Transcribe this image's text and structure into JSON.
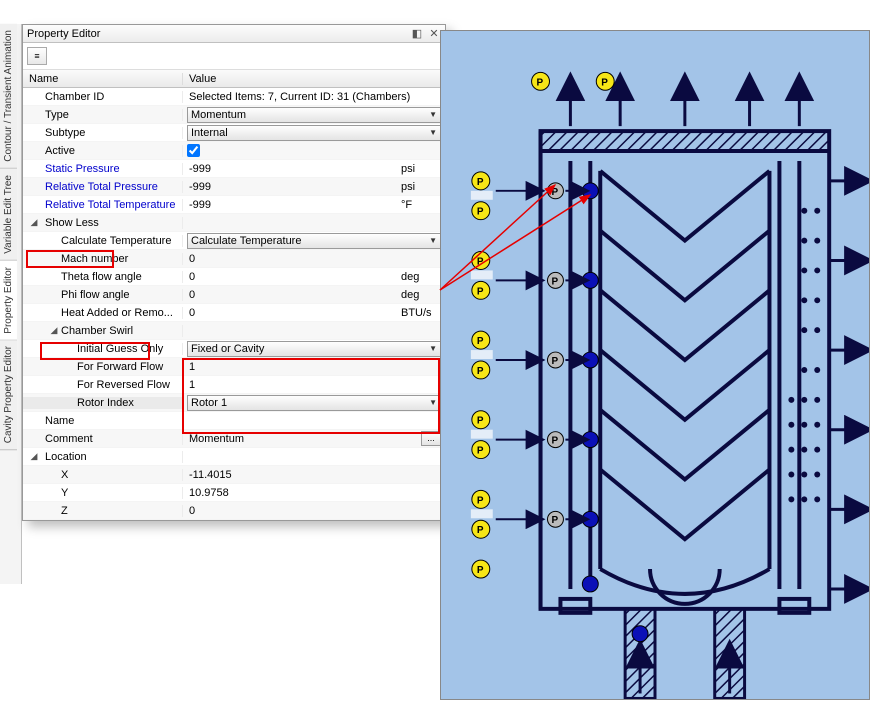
{
  "panel": {
    "title": "Property Editor",
    "toolbar_btn": "≡",
    "header_name": "Name",
    "header_value": "Value"
  },
  "vtabs": {
    "t1": "Contour / Transient Animation",
    "t2": "Variable Edit Tree",
    "t3": "Property Editor",
    "t4": "Cavity Property Editor"
  },
  "rows": {
    "chamber_id_label": "Chamber ID",
    "chamber_id_value": "Selected Items: 7, Current ID: 31 (Chambers)",
    "type_label": "Type",
    "type_value": "Momentum",
    "subtype_label": "Subtype",
    "subtype_value": "Internal",
    "active_label": "Active",
    "static_p_label": "Static Pressure",
    "static_p_value": "-999",
    "static_p_unit": "psi",
    "rel_totp_label": "Relative Total Pressure",
    "rel_totp_value": "-999",
    "rel_totp_unit": "psi",
    "rel_tott_label": "Relative Total Temperature",
    "rel_tott_value": "-999",
    "rel_tott_unit": "°F",
    "show_less_label": "Show Less",
    "calc_temp_label": "Calculate Temperature",
    "calc_temp_value": "Calculate Temperature",
    "mach_label": "Mach number",
    "mach_value": "0",
    "theta_label": "Theta flow angle",
    "theta_value": "0",
    "theta_unit": "deg",
    "phi_label": "Phi flow angle",
    "phi_value": "0",
    "phi_unit": "deg",
    "heat_label": "Heat Added or Remo...",
    "heat_value": "0",
    "heat_unit": "BTU/s",
    "chamber_swirl_label": "Chamber Swirl",
    "ig_label": "Initial Guess Only",
    "ig_value": "Fixed or Cavity",
    "fwd_label": "For Forward Flow",
    "fwd_value": "1",
    "rev_label": "For Reversed Flow",
    "rev_value": "1",
    "rotor_label": "Rotor Index",
    "rotor_value": "Rotor 1",
    "name_label": "Name",
    "name_value": "",
    "comment_label": "Comment",
    "comment_value": "Momentum",
    "comment_btn": "...",
    "location_label": "Location",
    "x_label": "X",
    "x_value": "-11.4015",
    "y_label": "Y",
    "y_value": "10.9758",
    "z_label": "Z",
    "z_value": "0"
  }
}
